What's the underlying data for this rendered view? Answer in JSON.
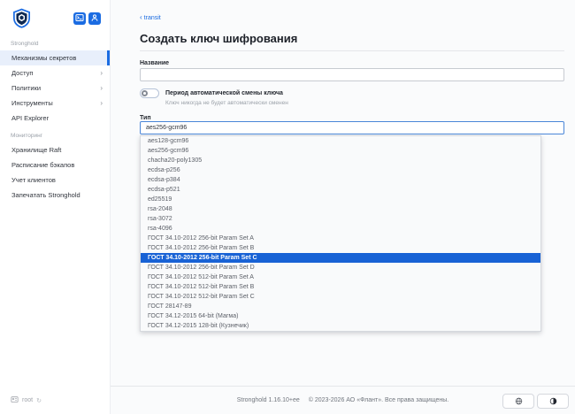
{
  "app": {
    "name": "Stronghold"
  },
  "colors": {
    "accent": "#1b6ce2",
    "dropdown_highlight": "#1862d5",
    "sidebar_selected_bg": "#e8effb"
  },
  "icons": {
    "breadcrumb_chevron": "‹",
    "sidebar_chevron": "›",
    "refresh": "↻"
  },
  "sidebar": {
    "section_main_label": "Stronghold",
    "items": [
      {
        "label": "Механизмы секретов",
        "selected": true
      },
      {
        "label": "Доступ",
        "chevron": true
      },
      {
        "label": "Политики",
        "chevron": true
      },
      {
        "label": "Инструменты",
        "chevron": true
      },
      {
        "label": "API Explorer"
      }
    ],
    "section_monitoring_label": "Мониторинг",
    "monitoring_items": [
      {
        "label": "Хранилище Raft"
      },
      {
        "label": "Расписание бэкапов"
      },
      {
        "label": "Учет клиентов"
      },
      {
        "label": "Запечатать Stronghold"
      }
    ],
    "status": {
      "user": "root"
    }
  },
  "main": {
    "breadcrumb": {
      "label": "transit"
    },
    "title": "Создать ключ шифрования",
    "name_field": {
      "label": "Название",
      "value": "",
      "placeholder": ""
    },
    "rotation_toggle": {
      "label": "Период автоматической смены ключа",
      "helper": "Ключ никогда не будет автоматически сменен",
      "enabled": false
    },
    "type_field": {
      "label": "Тип",
      "value": "aes256-gcm96"
    },
    "type_options": [
      {
        "label": "aes128-gcm96"
      },
      {
        "label": "aes256-gcm96"
      },
      {
        "label": "chacha20-poly1305"
      },
      {
        "label": "ecdsa-p256"
      },
      {
        "label": "ecdsa-p384"
      },
      {
        "label": "ecdsa-p521"
      },
      {
        "label": "ed25519"
      },
      {
        "label": "rsa-2048"
      },
      {
        "label": "rsa-3072"
      },
      {
        "label": "rsa-4096"
      },
      {
        "label": "ГОСТ 34.10-2012 256-bit Param Set A"
      },
      {
        "label": "ГОСТ 34.10-2012 256-bit Param Set B"
      },
      {
        "label": "ГОСТ 34.10-2012 256-bit Param Set C",
        "highlighted": true
      },
      {
        "label": "ГОСТ 34.10-2012 256-bit Param Set D"
      },
      {
        "label": "ГОСТ 34.10-2012 512-bit Param Set A"
      },
      {
        "label": "ГОСТ 34.10-2012 512-bit Param Set B"
      },
      {
        "label": "ГОСТ 34.10-2012 512-bit Param Set C"
      },
      {
        "label": "ГОСТ 28147-89"
      },
      {
        "label": "ГОСТ 34.12-2015 64-bit (Магма)"
      },
      {
        "label": "ГОСТ 34.12-2015 128-bit (Кузнечик)"
      }
    ]
  },
  "footer": {
    "version": "Stronghold 1.16.10+ee",
    "copyright": "© 2023-2026 АО «Флант». Все права защищены."
  }
}
